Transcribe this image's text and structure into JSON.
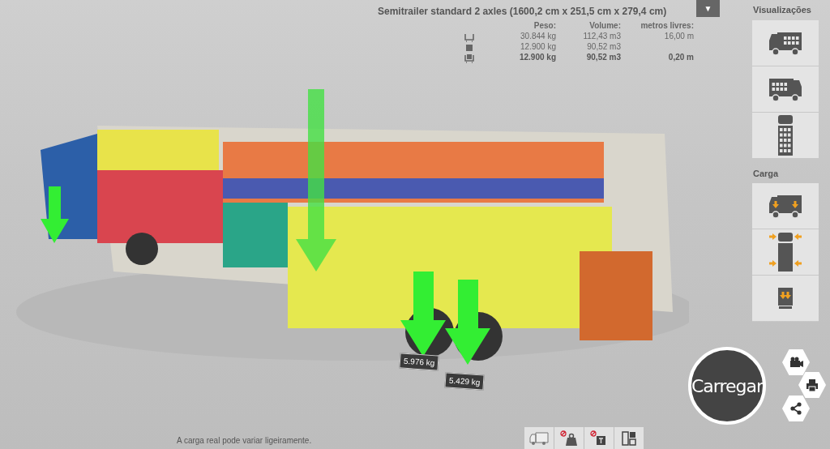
{
  "scene": {
    "kind": "picture"
  },
  "summary": {
    "title": "Semitrailer standard 2 axles (1600,2 cm x 251,5 cm x 279,4 cm)",
    "columns": [
      "Peso:",
      "Volume:",
      "metros livres:"
    ],
    "rows": [
      {
        "kind": "capacity",
        "cells": [
          "30.844 kg",
          "112,43 m3",
          "16,00 m"
        ]
      },
      {
        "kind": "cargo",
        "cells": [
          "12.900 kg",
          "90,52 m3"
        ]
      },
      {
        "kind": "loaded",
        "cells": [
          "12.900 kg",
          "90,52 m3",
          "0,20 m"
        ]
      }
    ]
  },
  "menu_button": {
    "glyph": "▼"
  },
  "sidebar": [
    {
      "title": "Visualizações",
      "buttons": [
        {
          "kind": "side-left"
        },
        {
          "kind": "side-right"
        },
        {
          "kind": "top"
        }
      ]
    },
    {
      "title": "Carga",
      "buttons": [
        {
          "kind": "axle-load"
        },
        {
          "kind": "top-arrows"
        },
        {
          "kind": "rear-load"
        }
      ]
    }
  ],
  "axle_loads": [
    "5.976 kg",
    "5.429 kg"
  ],
  "load_button": "Carregar",
  "actions": [
    {
      "kind": "camera"
    },
    {
      "kind": "print"
    },
    {
      "kind": "share"
    }
  ],
  "footer_note": "A carga real pode variar ligeiramente.",
  "toolbar": [
    {
      "kind": "truck"
    },
    {
      "kind": "no-weight"
    },
    {
      "kind": "no-text"
    },
    {
      "kind": "layout"
    }
  ]
}
